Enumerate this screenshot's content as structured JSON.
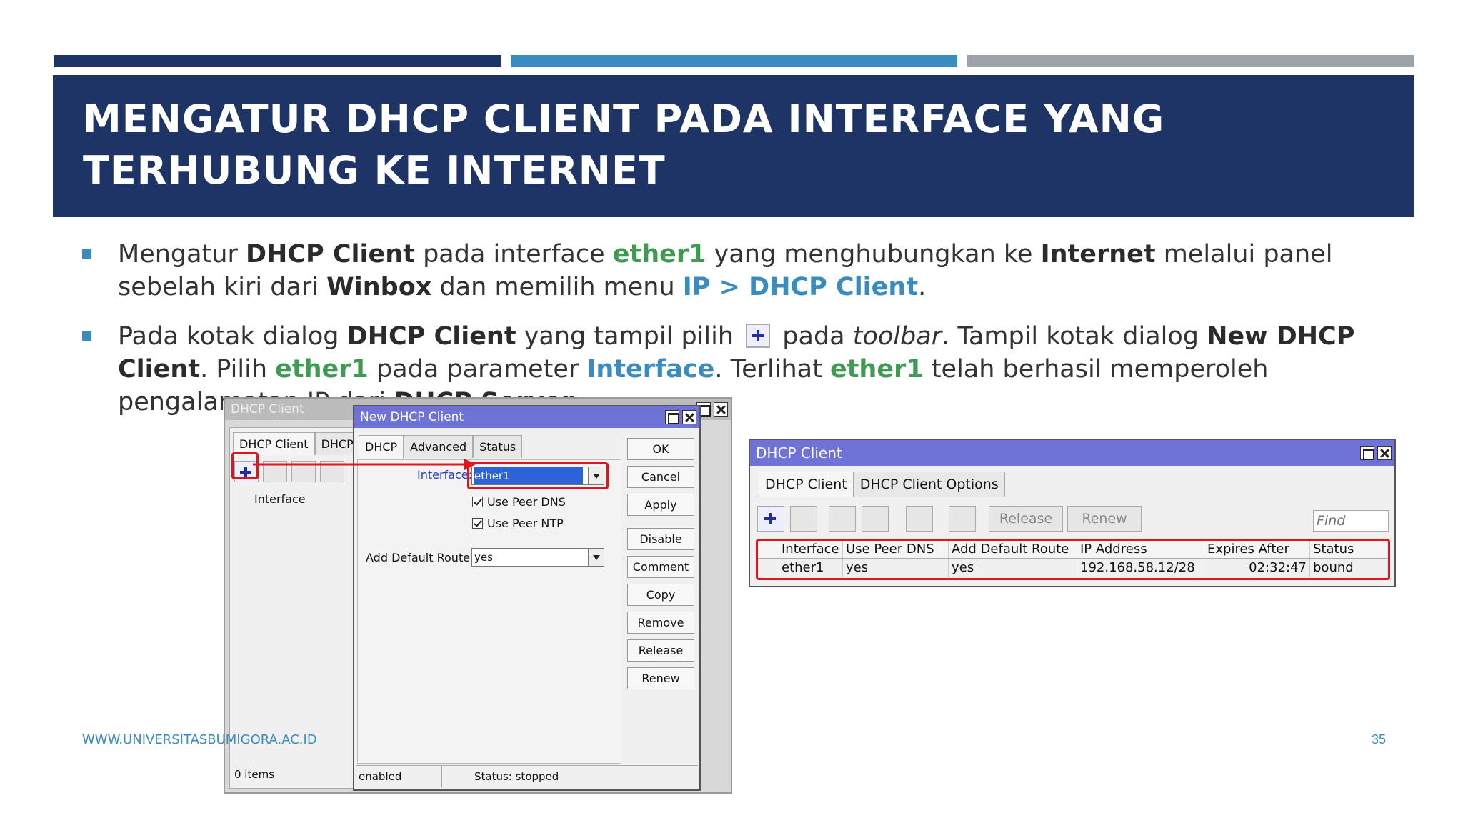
{
  "slide": {
    "title": "MENGATUR DHCP CLIENT PADA INTERFACE YANG TERHUBUNG KE INTERNET",
    "footer_url": "WWW.UNIVERSITASBUMIGORA.AC.ID",
    "page_number": "35",
    "colors": {
      "navy": "#1f3466",
      "blue": "#3a8bc0",
      "gray": "#9ea3aa",
      "green": "#3f9a52"
    }
  },
  "bullet1": {
    "t1": "Mengatur ",
    "k1": "DHCP Client",
    "t2": " pada interface ",
    "g1": "ether1",
    "t3": " yang menghubungkan ke ",
    "k2": "Internet",
    "t4": " melalui panel sebelah kiri dari ",
    "k3": "Winbox",
    "t5": " dan memilih menu ",
    "b1": "IP > DHCP Client",
    "t6": "."
  },
  "bullet2": {
    "t1": "Pada kotak dialog ",
    "k1": "DHCP Client",
    "t2": " yang tampil pilih ",
    "t3": " pada ",
    "i1": "toolbar",
    "t4": ".  Tampil kotak dialog ",
    "k2": "New DHCP Client",
    "t5": ". Pilih ",
    "g1": "ether1",
    "t6": " pada parameter ",
    "b1": "Interface",
    "t7": ". Terlihat ",
    "g2": "ether1",
    "t8": " telah berhasil memperoleh pengalamatan IP dari ",
    "k3": "DHCP Server",
    "t9": "."
  },
  "bg_window": {
    "title": "DHCP Client",
    "tabs": [
      "DHCP Client",
      "DHCP C"
    ],
    "column_interface": "Interface",
    "status": "0 items"
  },
  "dialog": {
    "title": "New DHCP Client",
    "tabs": [
      "DHCP",
      "Advanced",
      "Status"
    ],
    "interface_label": "Interface:",
    "interface_value": "ether1",
    "use_peer_dns": "Use Peer DNS",
    "use_peer_ntp": "Use Peer NTP",
    "add_default_route_label": "Add Default Route:",
    "add_default_route_value": "yes",
    "buttons": [
      "OK",
      "Cancel",
      "Apply",
      "Disable",
      "Comment",
      "Copy",
      "Remove",
      "Release",
      "Renew"
    ],
    "status_left": "enabled",
    "status_right": "Status: stopped"
  },
  "right_window": {
    "title": "DHCP Client",
    "tabs": [
      "DHCP Client",
      "DHCP Client Options"
    ],
    "toolbar": {
      "release": "Release",
      "renew": "Renew",
      "find_placeholder": "Find"
    },
    "columns": [
      "Interface",
      "Use Peer DNS",
      "Add Default Route",
      "IP Address",
      "Expires After",
      "Status"
    ],
    "rows": [
      [
        "ether1",
        "yes",
        "yes",
        "192.168.58.12/28",
        "02:32:47",
        "bound"
      ]
    ]
  }
}
